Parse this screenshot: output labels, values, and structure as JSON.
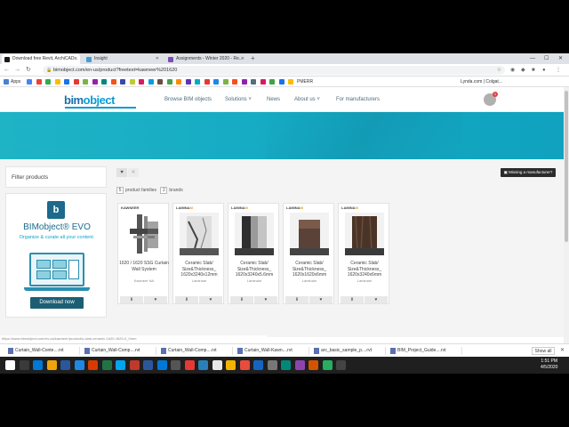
{
  "browser": {
    "tabs": [
      {
        "title": "Download free Revit, ArchiCAD...",
        "color": "#1a1a1a"
      },
      {
        "title": "Insight",
        "color": "#4a9ad4"
      },
      {
        "title": "Assignments - Winter 2020 - Re...",
        "color": "#7a4fb3"
      }
    ],
    "url": "bimobject.com/en-us/product?freetext=kawneer%201620",
    "bookmarks_label": "Apps",
    "bookmark_texts": [
      "PMERR",
      "Lynda.com | Colgat..."
    ],
    "bookmark_colors": [
      "#4285f4",
      "#ea4335",
      "#34a853",
      "#fbbc05",
      "#1a73e8",
      "#e53935",
      "#7cb342",
      "#8e24aa",
      "#00897b",
      "#f4511e",
      "#3949ab",
      "#c0ca33",
      "#d81b60",
      "#039be5",
      "#6d4c41",
      "#43a047",
      "#fb8c00",
      "#5e35b1",
      "#00acc1",
      "#e53935",
      "#1e88e5",
      "#7cb342",
      "#f4511e",
      "#8e24aa",
      "#546e7a",
      "#d81b60",
      "#43a047",
      "#1a73e8",
      "#fbbc05",
      "#ea4335"
    ]
  },
  "site": {
    "logo_main": "bim",
    "logo_accent": "object",
    "nav": [
      "Browse BIM objects",
      "Solutions",
      "News",
      "About us",
      "For manufacturers"
    ],
    "avatar_badge": "1"
  },
  "sidebar": {
    "filter_label": "Filter products",
    "promo_title": "BIMobject® EVO",
    "promo_subtitle": "Organize & curate all your content.",
    "promo_button": "Download now"
  },
  "toolbar": {
    "heart": "♥",
    "share": "<",
    "missing": "Missing a manufacturer?",
    "product_families_count": "5",
    "product_families_label": "product families",
    "brands_count": "2",
    "brands_label": "brands"
  },
  "products": [
    {
      "brand": "KAWNEER",
      "brand_m": "",
      "title": "1620 / 1620 SSG Curtain Wall System",
      "brand_name": "Kawneer NA",
      "img": "kawneer"
    },
    {
      "brand": "LAMINA",
      "brand_m": "M",
      "title": "Ceramic Slab/ Size&Thickness_ 1620x3240x12mm",
      "brand_name": "Laminam",
      "img": "marble"
    },
    {
      "brand": "LAMINA",
      "brand_m": "M",
      "title": "Ceramic Slab/ Size&Thickness_ 1620x3240x5.6mm",
      "brand_name": "Laminam",
      "img": "dark"
    },
    {
      "brand": "LAMINA",
      "brand_m": "M",
      "title": "Ceramic Slab/ Size&Thickness_ 1620x1620x6mm",
      "brand_name": "Laminam",
      "img": "brown"
    },
    {
      "brand": "LAMINA",
      "brand_m": "M",
      "title": "Ceramic Slab/ Size&Thickness_ 1620x3240x6mm",
      "brand_name": "Laminam",
      "img": "wood"
    }
  ],
  "status_url": "https://www.bimobject.com/en-us/kawneer/product/s-slab-ceramic-1620-1620-0_0mm",
  "downloads": [
    "Curtain_Wall-Conte....rvt",
    "Curtain_Wall-Comp....rvt",
    "Curtain_Wall-Comp....rvt",
    "Curtain_Wall-Kawn....rvt",
    "arc_basic_sample_p....rvt",
    "BIM_Project_Guide....rvt"
  ],
  "show_all": "Show all",
  "clock": {
    "time": "1:51 PM",
    "date": "4/5/2020"
  },
  "taskbar_colors": [
    "#fff",
    "#3a3a3a",
    "#0078d7",
    "#f0a30a",
    "#2b579a",
    "#1e88e5",
    "#d83b01",
    "#217346",
    "#00a4ef",
    "#c0392b",
    "#2b579a",
    "#0078d7",
    "#555",
    "#e53935",
    "#2980b9",
    "#e8e8e8",
    "#f4b400",
    "#e74c3c",
    "#1565c0",
    "#777",
    "#00897b",
    "#8e44ad",
    "#d35400",
    "#27ae60",
    "#444"
  ]
}
